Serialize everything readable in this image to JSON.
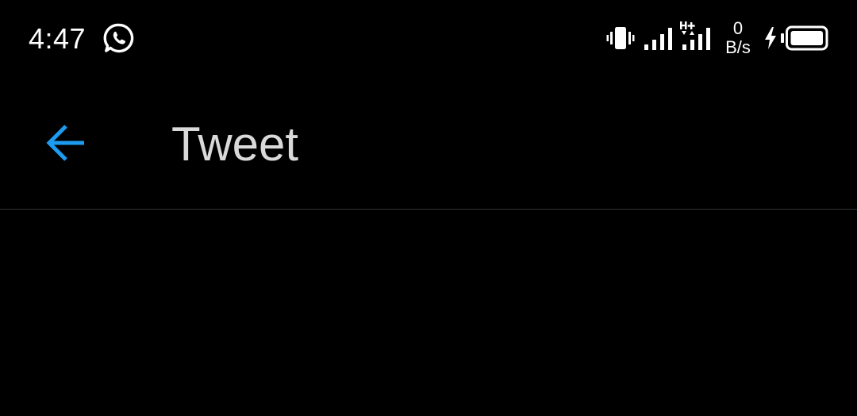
{
  "status_bar": {
    "time": "4:47",
    "net_speed_value": "0",
    "net_speed_unit": "B/s",
    "icons": [
      "whatsapp-icon",
      "vibrate-icon",
      "signal-icon",
      "signal-hplus-icon",
      "charging-icon",
      "battery-icon"
    ]
  },
  "toolbar": {
    "title": "Tweet",
    "back_icon": "arrow-left-icon"
  },
  "colors": {
    "background": "#000000",
    "accent": "#1d9bf0",
    "title_text": "#d9d9d9",
    "divider": "#2f3336"
  }
}
